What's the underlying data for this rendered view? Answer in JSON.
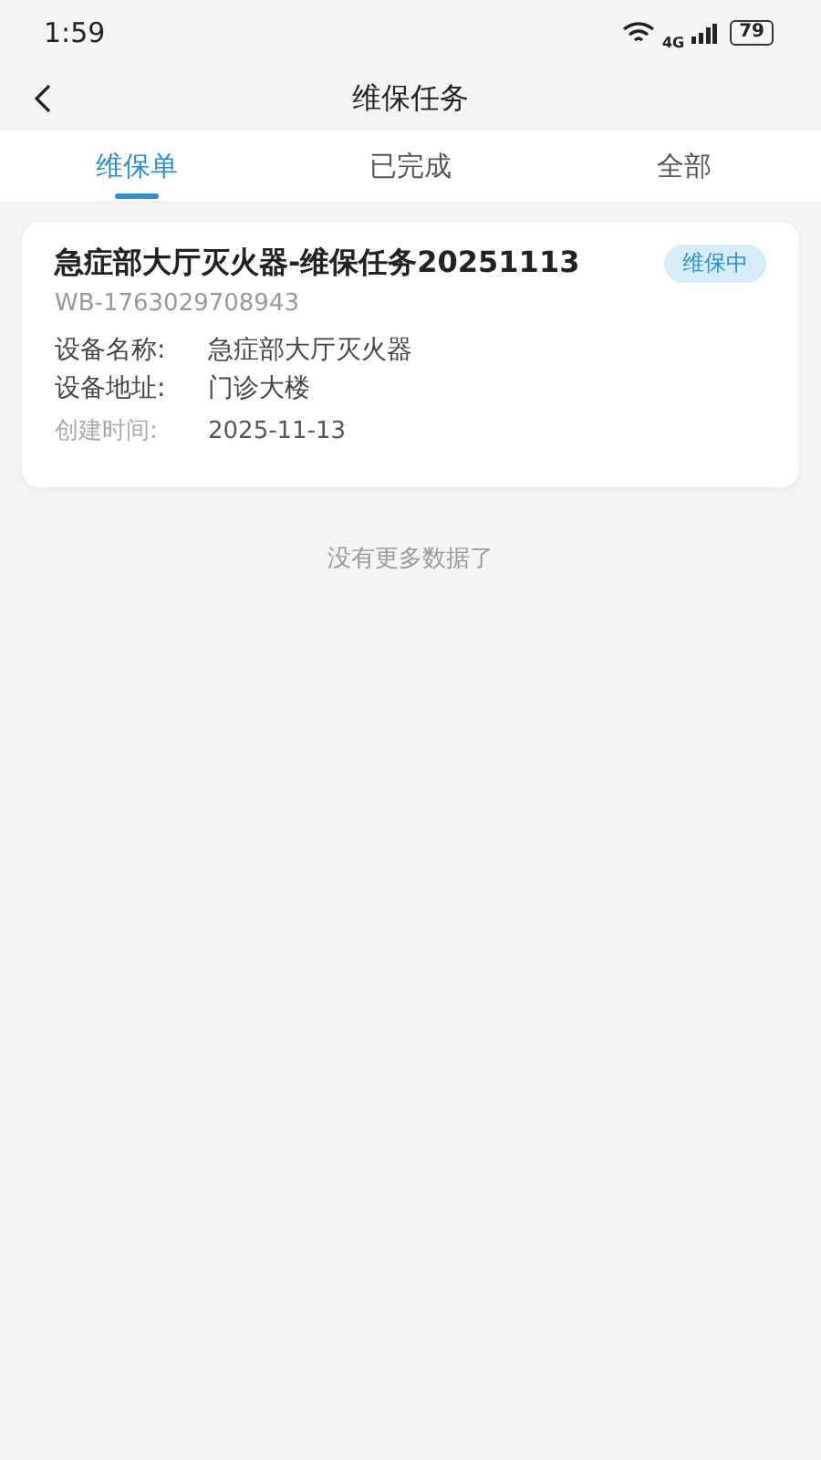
{
  "status_bar": {
    "time": "1:59",
    "network": "4G",
    "battery": "79"
  },
  "nav": {
    "title": "维保任务"
  },
  "tabs": [
    {
      "label": "维保单",
      "selected": true
    },
    {
      "label": "已完成",
      "selected": false
    },
    {
      "label": "全部",
      "selected": false
    }
  ],
  "tasks": [
    {
      "title": "急症部大厅灭火器-维保任务20251113",
      "status": "维保中",
      "code": "WB-1763029708943",
      "fields": [
        {
          "kind": "detail",
          "label": "设备名称:",
          "value": "急症部大厅灭火器"
        },
        {
          "kind": "detail",
          "label": "设备地址:",
          "value": "门诊大楼"
        },
        {
          "kind": "meta",
          "label": "创建时间:",
          "value": "2025-11-13"
        }
      ]
    }
  ],
  "footer": "没有更多数据了"
}
